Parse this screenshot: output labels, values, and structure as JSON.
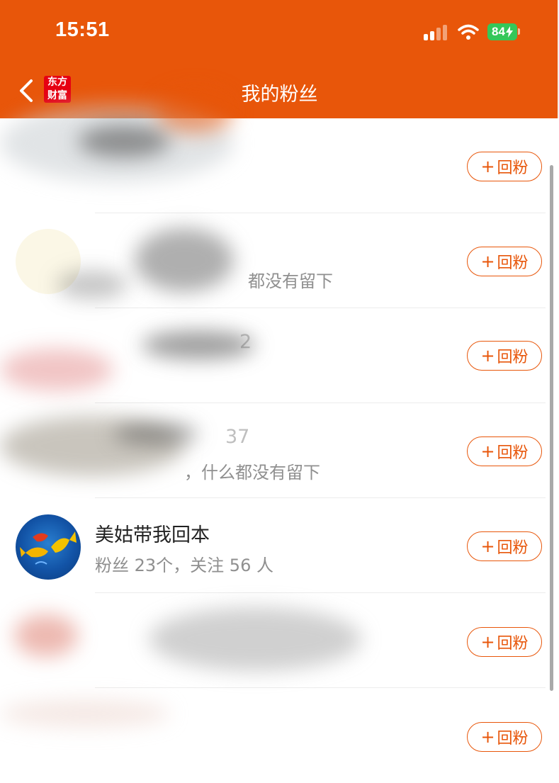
{
  "status_bar": {
    "time": "15:51",
    "battery_percent": "84",
    "icons": [
      "cellular-signal-icon",
      "wifi-icon",
      "battery-charging-icon"
    ]
  },
  "nav": {
    "back_icon": "chevron-left-icon",
    "logo_lines": [
      "东方",
      "财富"
    ],
    "title": "我的粉丝"
  },
  "colors": {
    "brand": "#e8560a",
    "logo_red": "#e60012",
    "battery_green": "#34c759",
    "muted_text": "#8f8f8f"
  },
  "fans": [
    {
      "name": "",
      "desc": "",
      "follow_label": "回粉",
      "redacted": true
    },
    {
      "name": "",
      "desc": "都没有留下",
      "follow_label": "回粉",
      "redacted": true
    },
    {
      "name": "2",
      "desc": "",
      "follow_label": "回粉",
      "redacted": true
    },
    {
      "name": "37",
      "desc": "，什么都没有留下",
      "follow_label": "回粉",
      "redacted": true
    },
    {
      "name": "美姑带我回本",
      "desc": "粉丝 23个，关注 56 人",
      "follow_label": "回粉",
      "redacted": false
    },
    {
      "name": "",
      "desc": "",
      "follow_label": "回粉",
      "redacted": true
    },
    {
      "name": "",
      "desc": "",
      "follow_label": "回粉",
      "redacted": true
    }
  ]
}
